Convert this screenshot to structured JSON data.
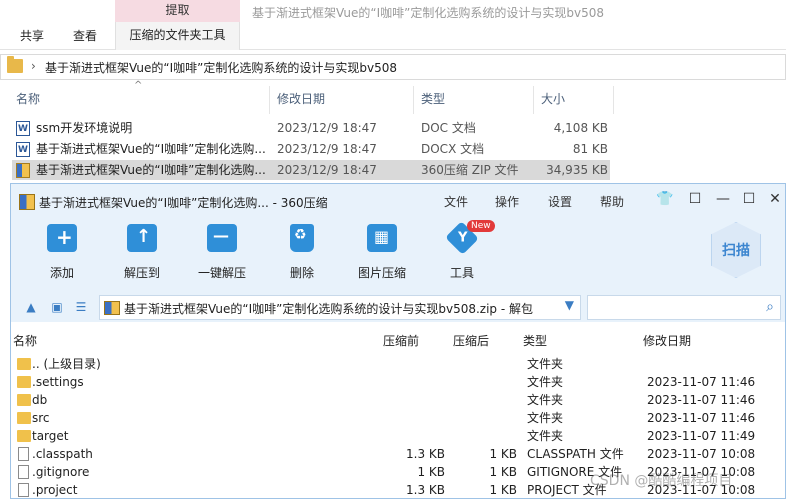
{
  "ribbon": {
    "context_tab": "提取",
    "context_sub": "压缩的文件夹工具",
    "window_title": "基于渐进式框架Vue的“I咖啡”定制化选购系统的设计与实现bv508",
    "tabs": [
      "共享",
      "查看"
    ]
  },
  "address": {
    "path": "基于渐进式框架Vue的“I咖啡”定制化选购系统的设计与实现bv508"
  },
  "explorer": {
    "headers": [
      "名称",
      "修改日期",
      "类型",
      "大小"
    ],
    "rows": [
      {
        "name": "ssm开发环境说明",
        "date": "2023/12/9 18:47",
        "type": "DOC 文档",
        "size": "4,108 KB"
      },
      {
        "name": "基于渐进式框架Vue的“I咖啡”定制化选购...",
        "date": "2023/12/9 18:47",
        "type": "DOCX 文档",
        "size": "81 KB"
      },
      {
        "name": "基于渐进式框架Vue的“I咖啡”定制化选购...",
        "date": "2023/12/9 18:47",
        "type": "360压缩 ZIP 文件",
        "size": "34,935 KB"
      }
    ]
  },
  "zip": {
    "title": "基于渐进式框架Vue的“I咖啡”定制化选购... - 360压缩",
    "menu": [
      "文件",
      "操作",
      "设置",
      "帮助"
    ],
    "toolbar": [
      "添加",
      "解压到",
      "一键解压",
      "删除",
      "图片压缩",
      "工具"
    ],
    "new_badge": "New",
    "scan": "扫描",
    "path": "基于渐进式框架Vue的“I咖啡”定制化选购系统的设计与实现bv508.zip - 解包",
    "headers": [
      "名称",
      "压缩前",
      "压缩后",
      "类型",
      "修改日期"
    ],
    "rows": [
      {
        "name": ".. (上级目录)",
        "before": "",
        "after": "",
        "type": "文件夹",
        "date": "",
        "kind": "folder"
      },
      {
        "name": ".settings",
        "before": "",
        "after": "",
        "type": "文件夹",
        "date": "2023-11-07 11:46",
        "kind": "folder"
      },
      {
        "name": "db",
        "before": "",
        "after": "",
        "type": "文件夹",
        "date": "2023-11-07 11:46",
        "kind": "folder"
      },
      {
        "name": "src",
        "before": "",
        "after": "",
        "type": "文件夹",
        "date": "2023-11-07 11:46",
        "kind": "folder"
      },
      {
        "name": "target",
        "before": "",
        "after": "",
        "type": "文件夹",
        "date": "2023-11-07 11:49",
        "kind": "folder"
      },
      {
        "name": ".classpath",
        "before": "1.3 KB",
        "after": "1 KB",
        "type": "CLASSPATH 文件",
        "date": "2023-11-07 10:08",
        "kind": "file"
      },
      {
        "name": ".gitignore",
        "before": "1 KB",
        "after": "1 KB",
        "type": "GITIGNORE 文件",
        "date": "2023-11-07 10:08",
        "kind": "file"
      },
      {
        "name": ".project",
        "before": "1.3 KB",
        "after": "1 KB",
        "type": "PROJECT 文件",
        "date": "2023-11-07 10:08",
        "kind": "file"
      }
    ]
  },
  "watermark": "CSDN @酷酷编程项目",
  "colors": {
    "accent": "#2f8fd8",
    "zip_bg": "#e8f2fb",
    "ribbon_context": "#f6dbe2",
    "selected_row": "#d9d9d9"
  }
}
